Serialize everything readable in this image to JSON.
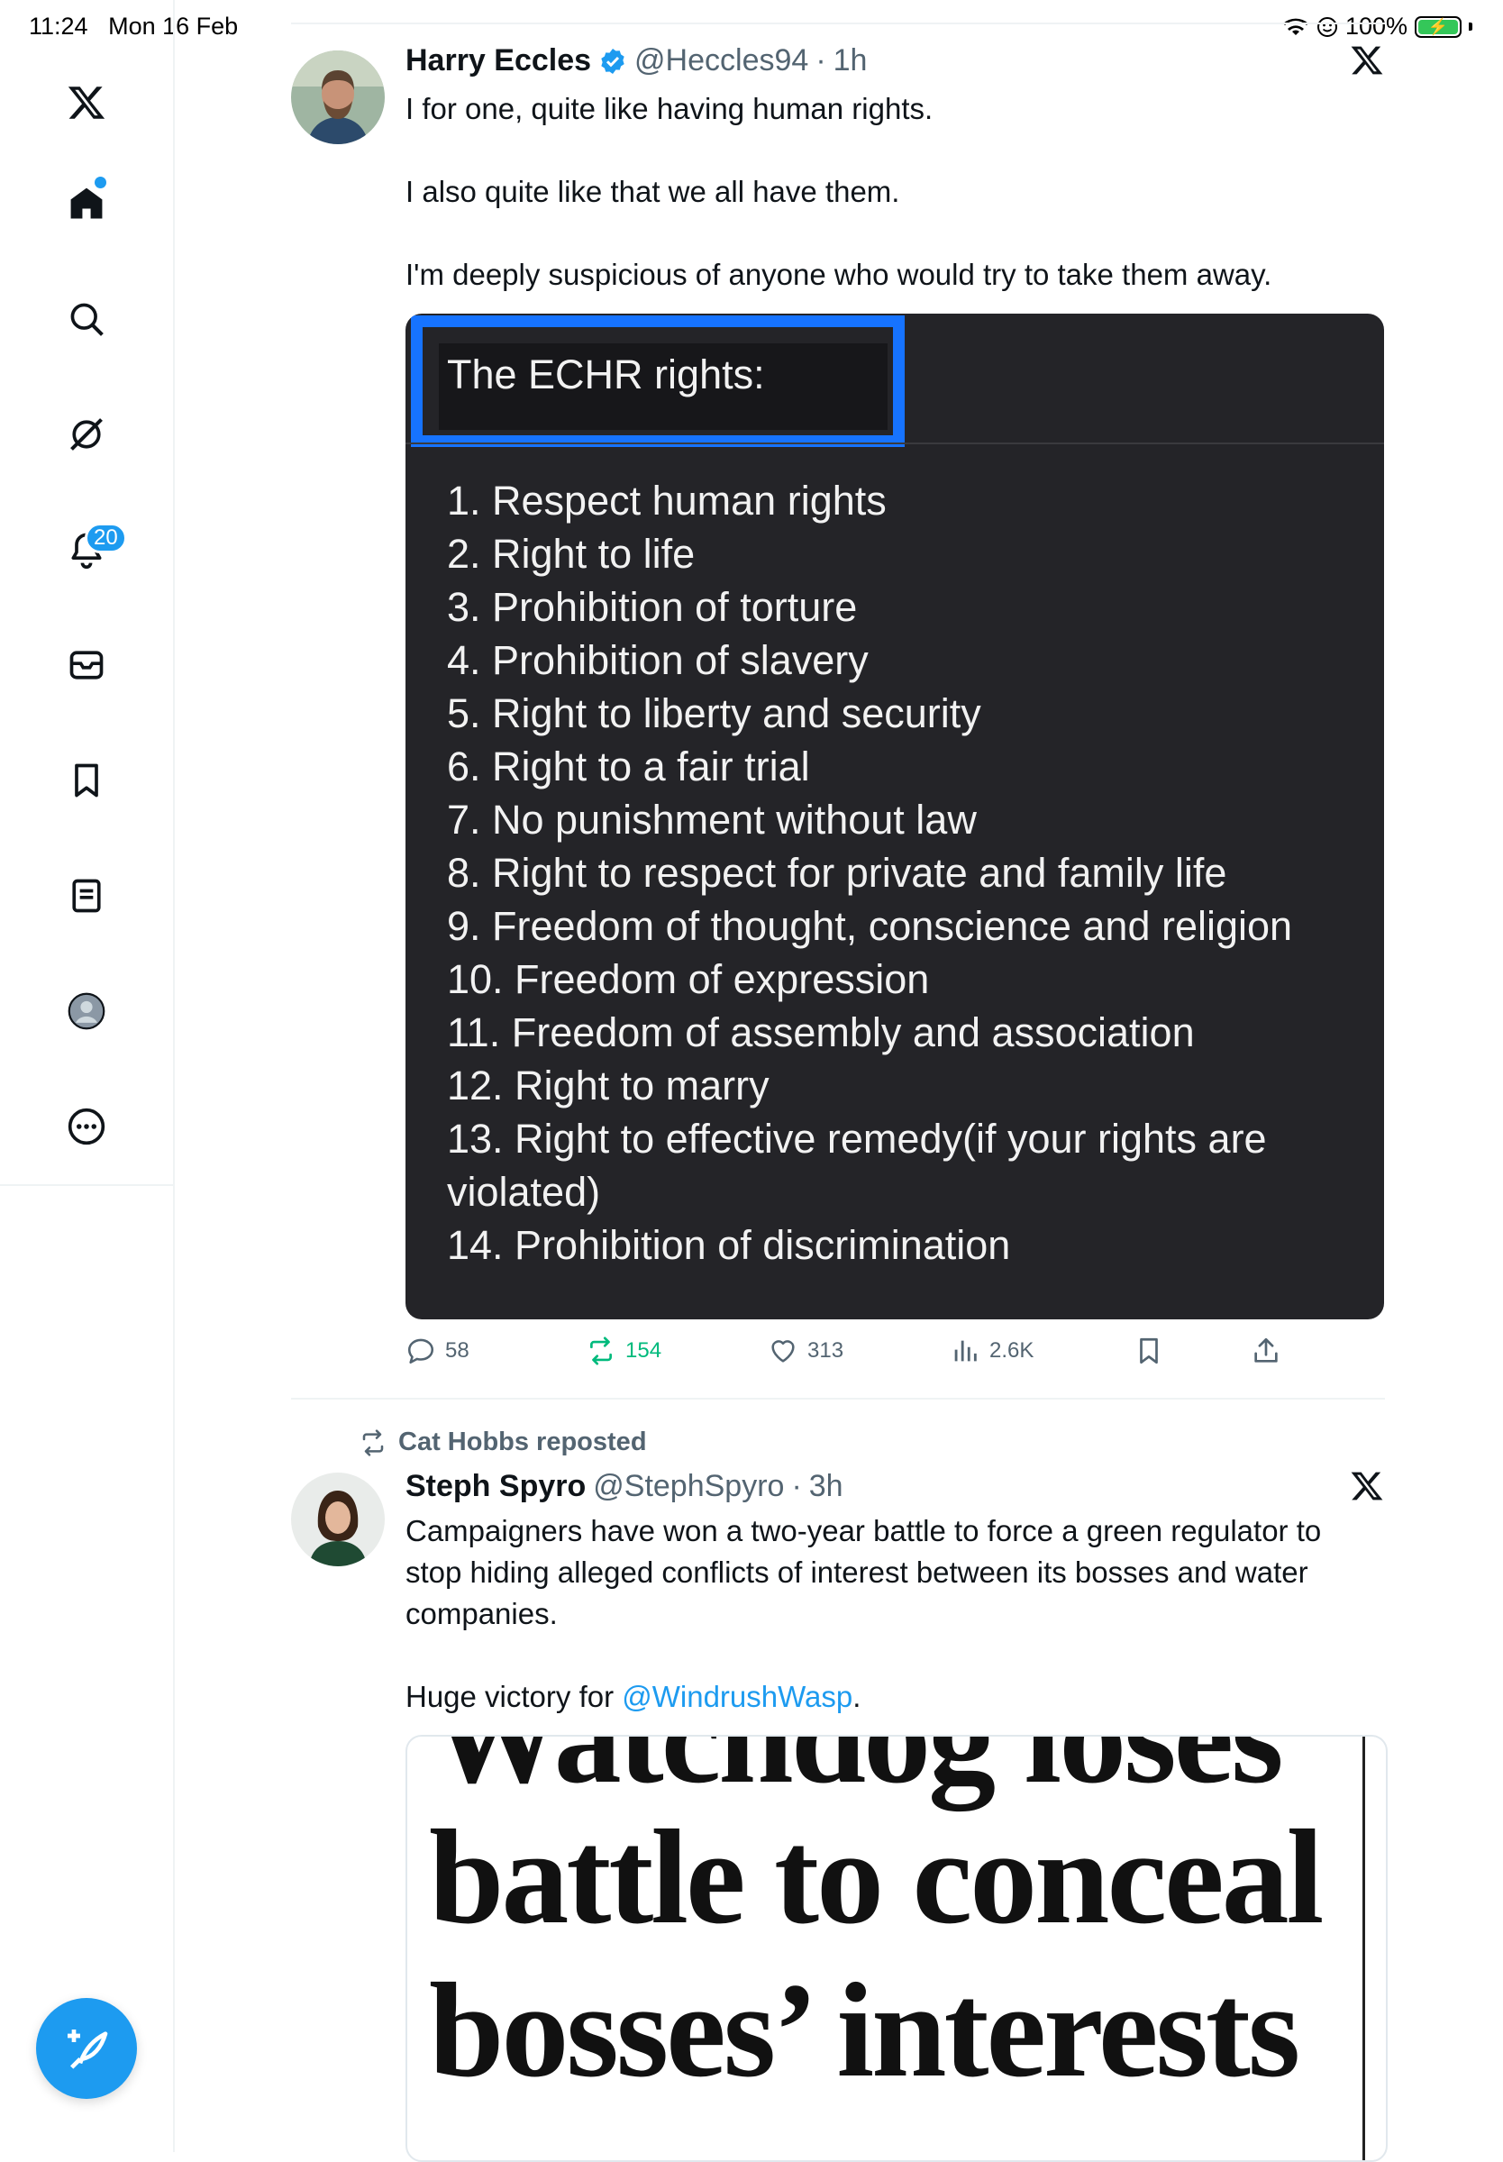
{
  "status": {
    "time": "11:24",
    "date": "Mon 16 Feb",
    "battery": "100%"
  },
  "sidebar": {
    "items": [
      "x-logo",
      "home",
      "search",
      "grok",
      "notifications",
      "messages",
      "bookmarks",
      "lists",
      "profile",
      "more"
    ],
    "notifications_badge": "20"
  },
  "tweet1": {
    "name": "Harry Eccles",
    "handle": "@Heccles94",
    "time": "1h",
    "text": "I for one, quite like having human rights.\n\nI also quite like that we all have them.\n\nI'm deeply suspicious of anyone who would try to take them away.",
    "card_title": "The ECHR rights:",
    "rights": [
      "1. Respect human rights",
      "2. Right to life",
      "3. Prohibition of torture",
      "4. Prohibition of slavery",
      "5. Right to liberty and security",
      "6. Right to a fair trial",
      "7. No punishment without law",
      "8. Right to respect for private and family life",
      "9. Freedom of thought, conscience and religion",
      "10. Freedom of expression",
      "11. Freedom of assembly and association",
      "12. Right to marry",
      "13. Right to effective remedy(if your rights are violated)",
      "14. Prohibition of discrimination"
    ],
    "replies": "58",
    "reposts": "154",
    "likes": "313",
    "views": "2.6K"
  },
  "tweet2": {
    "repost_label": "Cat Hobbs reposted",
    "name": "Steph Spyro",
    "handle": "@StephSpyro",
    "time": "3h",
    "text": "Campaigners have won a two-year battle to force a green regulator to stop hiding alleged conflicts of interest between its bosses and water companies.\n\n",
    "text_end_prefix": "Huge victory for ",
    "mention": "@WindrushWasp",
    "text_end_suffix": ".",
    "news_lines": [
      "Watchdog loses",
      "battle to conceal",
      "bosses’ interests"
    ]
  },
  "colors": {
    "accent": "#1d9bf0",
    "repost_green": "#00ba7c",
    "card_bg": "#242428",
    "highlight_box": "#1673ff"
  }
}
